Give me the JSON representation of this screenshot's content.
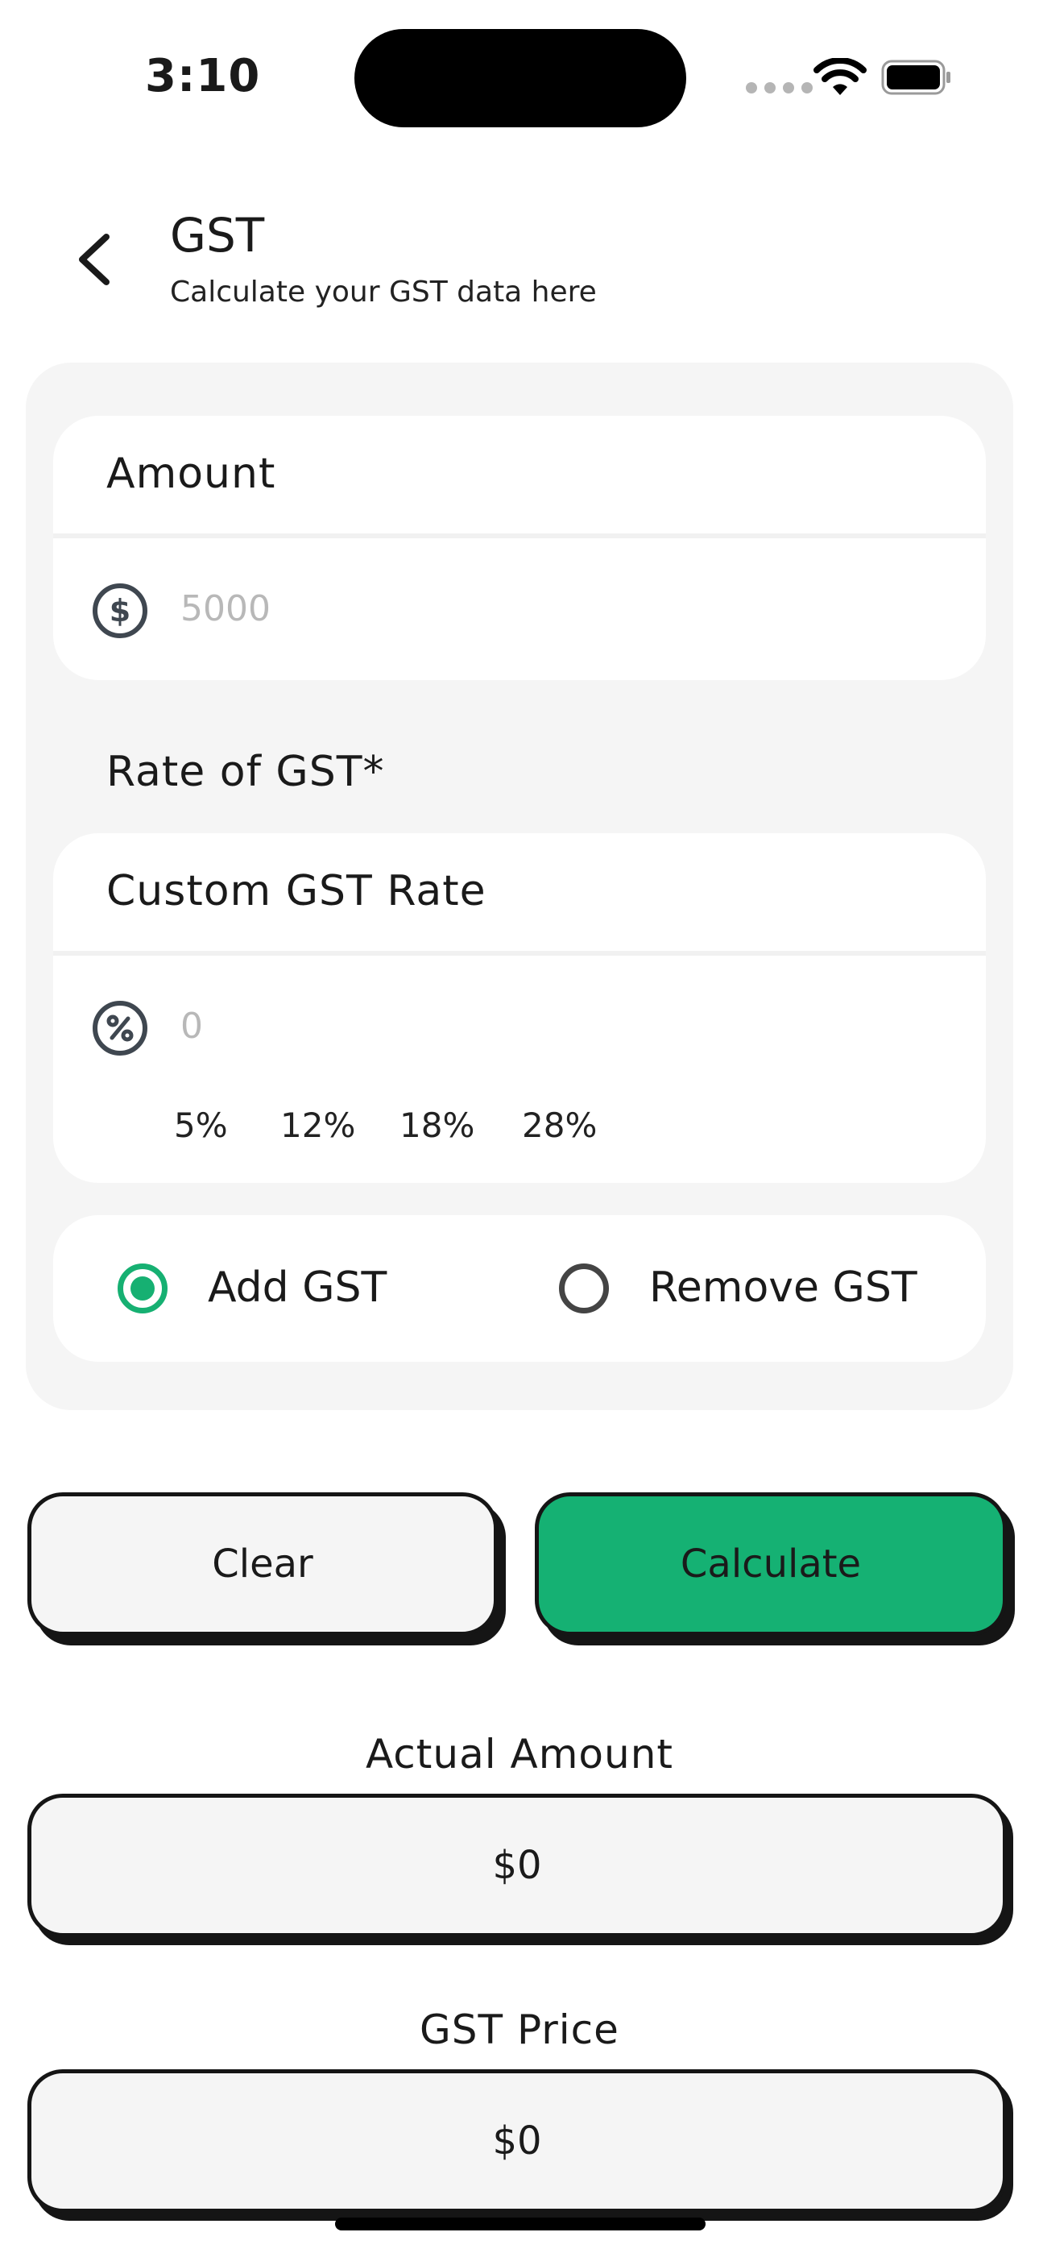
{
  "status_bar": {
    "time": "3:10"
  },
  "header": {
    "title": "GST",
    "subtitle": "Calculate your GST data here"
  },
  "amount": {
    "label": "Amount",
    "placeholder": "5000",
    "icon": "dollar-circle-icon"
  },
  "rate": {
    "section_label": "Rate of GST*",
    "custom_label": "Custom GST Rate",
    "placeholder": "0",
    "icon": "percent-circle-icon",
    "presets": [
      "5%",
      "12%",
      "18%",
      "28%"
    ]
  },
  "mode": {
    "options": [
      {
        "label": "Add GST",
        "selected": true
      },
      {
        "label": "Remove GST",
        "selected": false
      }
    ]
  },
  "actions": {
    "clear_label": "Clear",
    "calculate_label": "Calculate"
  },
  "results": {
    "actual_amount_label": "Actual Amount",
    "actual_amount_value": "$0",
    "gst_price_label": "GST Price",
    "gst_price_value": "$0"
  },
  "colors": {
    "accent": "#15b173",
    "panel": "#f5f5f5",
    "border": "#151515"
  }
}
